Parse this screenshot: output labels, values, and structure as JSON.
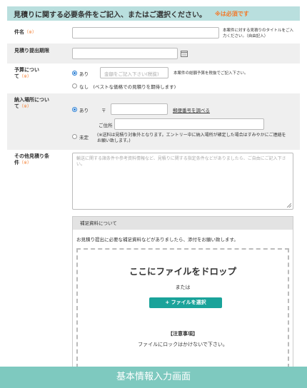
{
  "header": {
    "title": "見積りに関する必要条件をご記入、またはご選択ください。",
    "required_note": "※は必須です"
  },
  "required_mark": "（※）",
  "fields": {
    "subject": {
      "label": "件名",
      "value": "",
      "hint": "本案件に対する見積りのタイトルをご入力ください。（自由記入）"
    },
    "deadline": {
      "label": "見積り提出期限",
      "value": ""
    },
    "budget": {
      "label": "予算について",
      "option_yes": "あり",
      "amount_placeholder": "金額をご記入下さい(税抜)",
      "amount_hint": "本案件の総額予算を税抜でご記入下さい。",
      "option_no": "なし　(ベストな価格での見積りを期待します)",
      "selected": "あり"
    },
    "delivery": {
      "label": "納入場所について",
      "option_yes": "あり",
      "postal_mark": "〒",
      "postal_value": "",
      "postal_link": "郵便番号を調べる",
      "address_label": "ご住所",
      "address_value": "",
      "option_undecided": "未定",
      "undecided_note": "(※送料は見積り対象外となります。エントリー中に納入場所が確定した場合はすみやかにご連絡をお願い致します。)",
      "selected": "あり"
    },
    "other": {
      "label": "その他見積り条件",
      "placeholder": "輸送に関する諸条件や参考資料情報など、見積りに関する指定条件などがありましたら、ご自由にご記入下さい。"
    }
  },
  "upload": {
    "heading": "補足資料について",
    "description": "お見積り提出に必要な補足資料などがありましたら、添付をお願い致します。",
    "drop_title": "ここにファイルをドロップ",
    "or_text": "または",
    "select_button": "+ ファイルを選択",
    "notice_title": "【注意事項】",
    "notice_body": "ファイルにロックはかけないで下さい。"
  },
  "footer": {
    "caption": "基本情報入力画面"
  },
  "colors": {
    "header_bg": "#b9dfde",
    "required_orange": "#f27a2a",
    "button_teal": "#1aa39a",
    "footer_bg": "#7ec9bf",
    "radio_blue": "#2a7fd4"
  },
  "icons": {
    "calendar": "calendar-icon",
    "resize": "resize-handle-icon"
  }
}
